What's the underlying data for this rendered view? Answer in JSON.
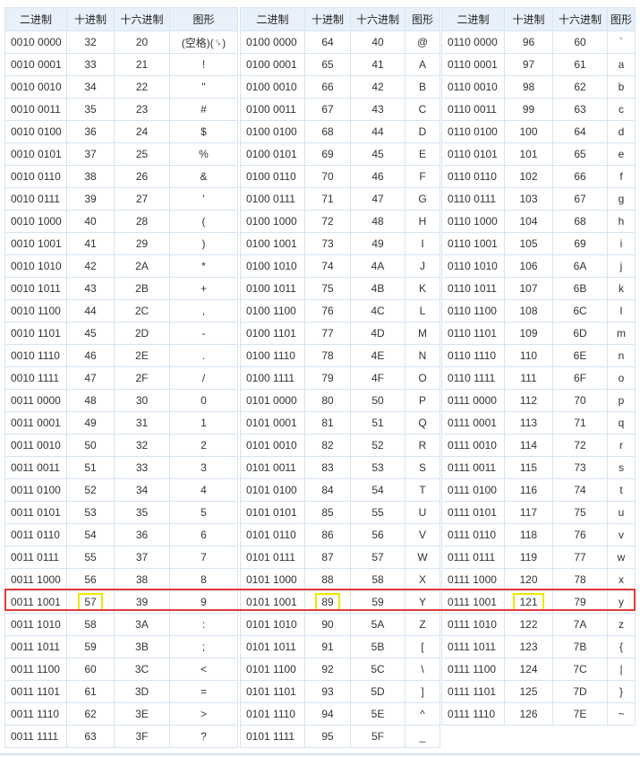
{
  "headers": [
    "二进制",
    "十进制",
    "十六进制",
    "图形"
  ],
  "highlighted_values": [
    "57",
    "89",
    "121"
  ],
  "tables": [
    {
      "rows": [
        [
          "0010 0000",
          "32",
          "20",
          "(空格)(␠)"
        ],
        [
          "0010 0001",
          "33",
          "21",
          "!"
        ],
        [
          "0010 0010",
          "34",
          "22",
          "\""
        ],
        [
          "0010 0011",
          "35",
          "23",
          "#"
        ],
        [
          "0010 0100",
          "36",
          "24",
          "$"
        ],
        [
          "0010 0101",
          "37",
          "25",
          "%"
        ],
        [
          "0010 0110",
          "38",
          "26",
          "&"
        ],
        [
          "0010 0111",
          "39",
          "27",
          "'"
        ],
        [
          "0010 1000",
          "40",
          "28",
          "("
        ],
        [
          "0010 1001",
          "41",
          "29",
          ")"
        ],
        [
          "0010 1010",
          "42",
          "2A",
          "*"
        ],
        [
          "0010 1011",
          "43",
          "2B",
          "+"
        ],
        [
          "0010 1100",
          "44",
          "2C",
          ","
        ],
        [
          "0010 1101",
          "45",
          "2D",
          "-"
        ],
        [
          "0010 1110",
          "46",
          "2E",
          "."
        ],
        [
          "0010 1111",
          "47",
          "2F",
          "/"
        ],
        [
          "0011 0000",
          "48",
          "30",
          "0"
        ],
        [
          "0011 0001",
          "49",
          "31",
          "1"
        ],
        [
          "0011 0010",
          "50",
          "32",
          "2"
        ],
        [
          "0011 0011",
          "51",
          "33",
          "3"
        ],
        [
          "0011 0100",
          "52",
          "34",
          "4"
        ],
        [
          "0011 0101",
          "53",
          "35",
          "5"
        ],
        [
          "0011 0110",
          "54",
          "36",
          "6"
        ],
        [
          "0011 0111",
          "55",
          "37",
          "7"
        ],
        [
          "0011 1000",
          "56",
          "38",
          "8"
        ],
        [
          "0011 1001",
          "57",
          "39",
          "9"
        ],
        [
          "0011 1010",
          "58",
          "3A",
          ":"
        ],
        [
          "0011 1011",
          "59",
          "3B",
          ";"
        ],
        [
          "0011 1100",
          "60",
          "3C",
          "<"
        ],
        [
          "0011 1101",
          "61",
          "3D",
          "="
        ],
        [
          "0011 1110",
          "62",
          "3E",
          ">"
        ],
        [
          "0011 1111",
          "63",
          "3F",
          "?"
        ]
      ]
    },
    {
      "rows": [
        [
          "0100 0000",
          "64",
          "40",
          "@"
        ],
        [
          "0100 0001",
          "65",
          "41",
          "A"
        ],
        [
          "0100 0010",
          "66",
          "42",
          "B"
        ],
        [
          "0100 0011",
          "67",
          "43",
          "C"
        ],
        [
          "0100 0100",
          "68",
          "44",
          "D"
        ],
        [
          "0100 0101",
          "69",
          "45",
          "E"
        ],
        [
          "0100 0110",
          "70",
          "46",
          "F"
        ],
        [
          "0100 0111",
          "71",
          "47",
          "G"
        ],
        [
          "0100 1000",
          "72",
          "48",
          "H"
        ],
        [
          "0100 1001",
          "73",
          "49",
          "I"
        ],
        [
          "0100 1010",
          "74",
          "4A",
          "J"
        ],
        [
          "0100 1011",
          "75",
          "4B",
          "K"
        ],
        [
          "0100 1100",
          "76",
          "4C",
          "L"
        ],
        [
          "0100 1101",
          "77",
          "4D",
          "M"
        ],
        [
          "0100 1110",
          "78",
          "4E",
          "N"
        ],
        [
          "0100 1111",
          "79",
          "4F",
          "O"
        ],
        [
          "0101 0000",
          "80",
          "50",
          "P"
        ],
        [
          "0101 0001",
          "81",
          "51",
          "Q"
        ],
        [
          "0101 0010",
          "82",
          "52",
          "R"
        ],
        [
          "0101 0011",
          "83",
          "53",
          "S"
        ],
        [
          "0101 0100",
          "84",
          "54",
          "T"
        ],
        [
          "0101 0101",
          "85",
          "55",
          "U"
        ],
        [
          "0101 0110",
          "86",
          "56",
          "V"
        ],
        [
          "0101 0111",
          "87",
          "57",
          "W"
        ],
        [
          "0101 1000",
          "88",
          "58",
          "X"
        ],
        [
          "0101 1001",
          "89",
          "59",
          "Y"
        ],
        [
          "0101 1010",
          "90",
          "5A",
          "Z"
        ],
        [
          "0101 1011",
          "91",
          "5B",
          "["
        ],
        [
          "0101 1100",
          "92",
          "5C",
          "\\"
        ],
        [
          "0101 1101",
          "93",
          "5D",
          "]"
        ],
        [
          "0101 1110",
          "94",
          "5E",
          "^"
        ],
        [
          "0101 1111",
          "95",
          "5F",
          "_"
        ]
      ]
    },
    {
      "rows": [
        [
          "0110 0000",
          "96",
          "60",
          "`"
        ],
        [
          "0110 0001",
          "97",
          "61",
          "a"
        ],
        [
          "0110 0010",
          "98",
          "62",
          "b"
        ],
        [
          "0110 0011",
          "99",
          "63",
          "c"
        ],
        [
          "0110 0100",
          "100",
          "64",
          "d"
        ],
        [
          "0110 0101",
          "101",
          "65",
          "e"
        ],
        [
          "0110 0110",
          "102",
          "66",
          "f"
        ],
        [
          "0110 0111",
          "103",
          "67",
          "g"
        ],
        [
          "0110 1000",
          "104",
          "68",
          "h"
        ],
        [
          "0110 1001",
          "105",
          "69",
          "i"
        ],
        [
          "0110 1010",
          "106",
          "6A",
          "j"
        ],
        [
          "0110 1011",
          "107",
          "6B",
          "k"
        ],
        [
          "0110 1100",
          "108",
          "6C",
          "l"
        ],
        [
          "0110 1101",
          "109",
          "6D",
          "m"
        ],
        [
          "0110 1110",
          "110",
          "6E",
          "n"
        ],
        [
          "0110 1111",
          "111",
          "6F",
          "o"
        ],
        [
          "0111 0000",
          "112",
          "70",
          "p"
        ],
        [
          "0111 0001",
          "113",
          "71",
          "q"
        ],
        [
          "0111 0010",
          "114",
          "72",
          "r"
        ],
        [
          "0111 0011",
          "115",
          "73",
          "s"
        ],
        [
          "0111 0100",
          "116",
          "74",
          "t"
        ],
        [
          "0111 0101",
          "117",
          "75",
          "u"
        ],
        [
          "0111 0110",
          "118",
          "76",
          "v"
        ],
        [
          "0111 0111",
          "119",
          "77",
          "w"
        ],
        [
          "0111 1000",
          "120",
          "78",
          "x"
        ],
        [
          "0111 1001",
          "121",
          "79",
          "y"
        ],
        [
          "0111 1010",
          "122",
          "7A",
          "z"
        ],
        [
          "0111 1011",
          "123",
          "7B",
          "{"
        ],
        [
          "0111 1100",
          "124",
          "7C",
          "|"
        ],
        [
          "0111 1101",
          "125",
          "7D",
          "}"
        ],
        [
          "0111 1110",
          "126",
          "7E",
          "~"
        ]
      ]
    }
  ]
}
